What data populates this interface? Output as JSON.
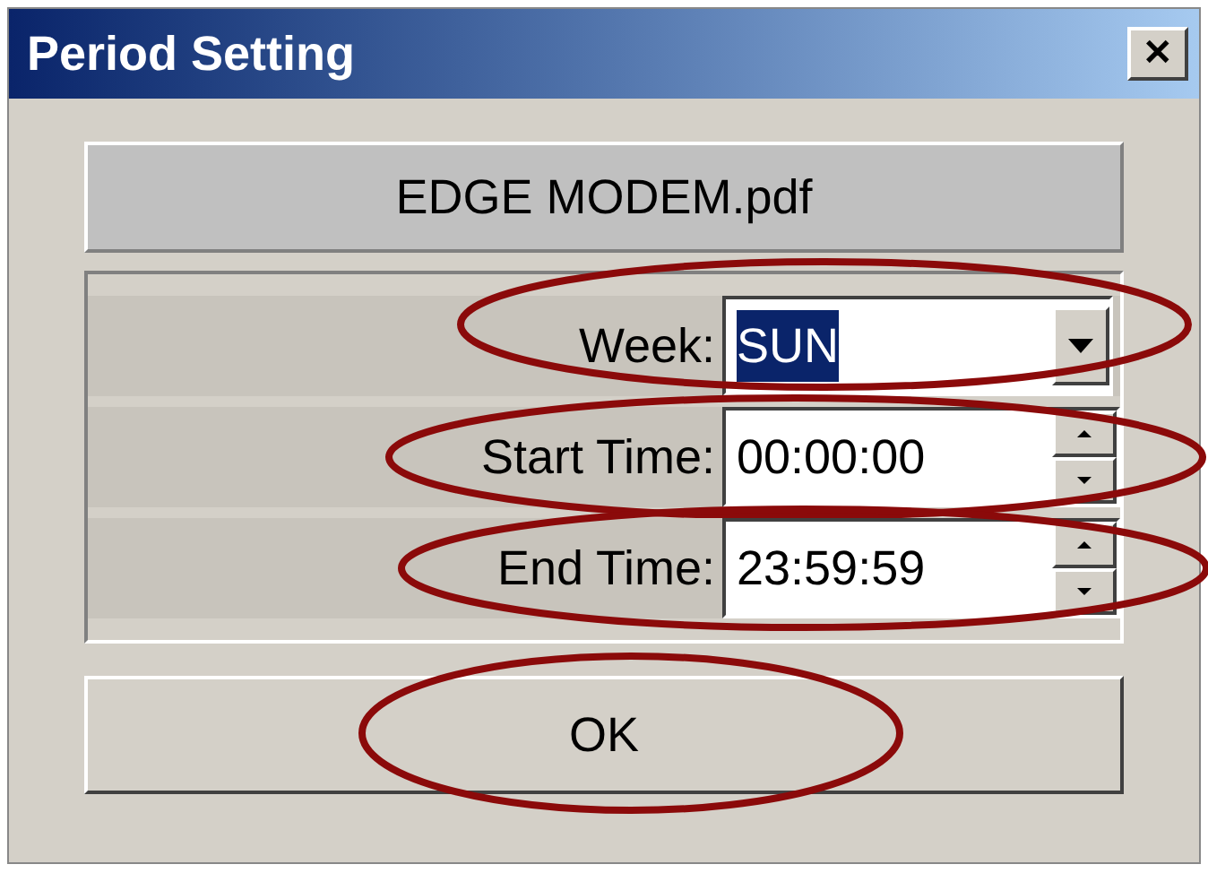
{
  "window": {
    "title": "Period Setting",
    "close": "✕"
  },
  "file_name": "EDGE MODEM.pdf",
  "fields": [
    {
      "kind": "dropdown",
      "label": "Week:",
      "value": "SUN",
      "value_selected": true,
      "circled": true
    },
    {
      "kind": "spinner",
      "label": "Start Time:",
      "value": "00:00:00",
      "value_selected": false,
      "circled": true
    },
    {
      "kind": "spinner",
      "label": "End Time:",
      "value": "23:59:59",
      "value_selected": false,
      "circled": true
    }
  ],
  "ok_button": {
    "label": "OK",
    "circled": true
  }
}
